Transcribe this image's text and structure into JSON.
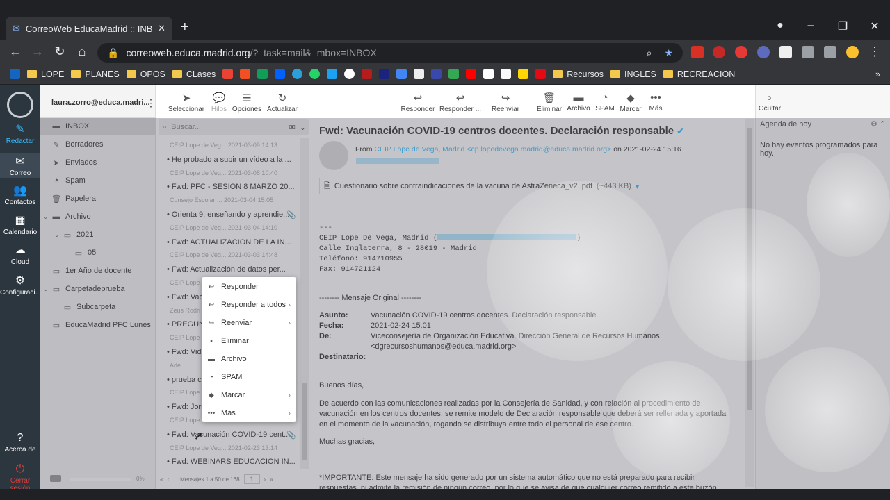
{
  "browser": {
    "tab_title": "CorreoWeb EducaMadrid :: INBOX",
    "url_host": "correoweb.educa.madrid.org",
    "url_path": "/?_task=mail&_mbox=INBOX",
    "bookmarks": [
      "LOPE",
      "PLANES",
      "OPOS",
      "CLases",
      "Recursos",
      "INGLES",
      "RECREACION"
    ]
  },
  "rail": {
    "items": [
      {
        "label": "Redactar",
        "icon": "compose-icon"
      },
      {
        "label": "Correo",
        "icon": "mail-icon"
      },
      {
        "label": "Contactos",
        "icon": "contacts-icon"
      },
      {
        "label": "Calendario",
        "icon": "calendar-icon"
      },
      {
        "label": "Cloud",
        "icon": "cloud-icon"
      },
      {
        "label": "Configuraci...",
        "icon": "gear-icon"
      },
      {
        "label": "Acerca de",
        "icon": "help-icon"
      },
      {
        "label": "Cerrar sesión",
        "icon": "power-icon"
      }
    ]
  },
  "user": {
    "email": "laura.zorro@educa.madri..."
  },
  "folders": [
    {
      "label": "INBOX",
      "icon": "inbox-icon"
    },
    {
      "label": "Borradores",
      "icon": "pencil-icon"
    },
    {
      "label": "Enviados",
      "icon": "send-icon"
    },
    {
      "label": "Spam",
      "icon": "spam-icon"
    },
    {
      "label": "Papelera",
      "icon": "trash-icon"
    },
    {
      "label": "Archivo",
      "icon": "archive-icon"
    },
    {
      "label": "2021",
      "icon": "folder-icon"
    },
    {
      "label": "05",
      "icon": "folder-icon"
    },
    {
      "label": "1er Año de docente",
      "icon": "folder-icon"
    },
    {
      "label": "Carpetadeprueba",
      "icon": "folder-icon"
    },
    {
      "label": "Subcarpeta",
      "icon": "folder-icon"
    },
    {
      "label": "EducaMadrid PFC Lunes",
      "icon": "folder-icon"
    }
  ],
  "list_toolbar": {
    "select": "Seleccionar",
    "threads": "Hilos",
    "options": "Opciones",
    "refresh": "Actualizar"
  },
  "search": {
    "placeholder": "Buscar..."
  },
  "messages": [
    {
      "meta": "CEIP Lope de Veg...  2021-03-09 14:13",
      "subject": ""
    },
    {
      "meta": "",
      "subject": "He probado a subir un vídeo a la ..."
    },
    {
      "meta": "CEIP Lope de Veg...  2021-03-08 10:40",
      "subject": ""
    },
    {
      "meta": "",
      "subject": "Fwd: PFC - SESIÓN 8 MARZO 20..."
    },
    {
      "meta": "Consejo Escolar ...  2021-03-04 15:05",
      "subject": ""
    },
    {
      "meta": "",
      "subject": "Orienta 9: enseñando y aprendie..."
    },
    {
      "meta": "CEIP Lope de Veg...  2021-03-04 14:10",
      "subject": ""
    },
    {
      "meta": "",
      "subject": "Fwd: ACTUALIZACION DE LA IN..."
    },
    {
      "meta": "CEIP Lope de Veg...  2021-03-03 14:48",
      "subject": ""
    },
    {
      "meta": "",
      "subject": "Fwd: Actualización de datos per..."
    },
    {
      "meta": "CEIP Lope",
      "subject": ""
    },
    {
      "meta": "",
      "subject": "Fwd: Vacu"
    },
    {
      "meta": "Zeus Rodri",
      "subject": ""
    },
    {
      "meta": "",
      "subject": "PREGUNT"
    },
    {
      "meta": "CEIP Lope",
      "subject": ""
    },
    {
      "meta": "",
      "subject": "Fwd: Vide"
    },
    {
      "meta": "Ade",
      "subject": ""
    },
    {
      "meta": "",
      "subject": "prueba cu"
    },
    {
      "meta": "CEIP Lope",
      "subject": ""
    },
    {
      "meta": "",
      "subject": "Fwd: Jorn"
    },
    {
      "meta": "CEIP Lope",
      "subject": ""
    },
    {
      "meta": "",
      "subject": "Fwd: Vacunación COVID-19 cent..."
    },
    {
      "meta": "CEIP Lope de Veg...  2021-02-23 13:14",
      "subject": ""
    },
    {
      "meta": "",
      "subject": "Fwd: WEBINARS EDUCACION IN..."
    }
  ],
  "pager": {
    "count": "Mensajes 1 a 50 de 168",
    "page": "1",
    "quota": "0%"
  },
  "msg_toolbar": {
    "reply": "Responder",
    "reply_all": "Responder ...",
    "forward": "Reenviar",
    "delete": "Eliminar",
    "archive": "Archivo",
    "spam": "SPAM",
    "mark": "Marcar",
    "more": "Más"
  },
  "message": {
    "subject": "Fwd: Vacunación COVID-19 centros docentes. Declaración responsable",
    "from_label": "From",
    "from": "CEIP Lope de Vega, Madrid <cp.lopedevega.madrid@educa.madrid.org>",
    "date": "on 2021-02-24 15:16",
    "attachment": "Cuestionario sobre contraindicaciones de la vacuna de AstraZeneca_v2 .pdf",
    "attachment_size": "(~443 KB)",
    "sig_sep": "---",
    "sig_l1": "CEIP Lope De Vega, Madrid (",
    "sig_l2": "Calle Inglaterra, 8 - 28019 - Madrid",
    "sig_l3": "Teléfono: 914710955",
    "sig_l4": "Fax: 914721124",
    "orig": "-------- Mensaje Original --------",
    "k_asunto": "Asunto:",
    "v_asunto": "Vacunación COVID-19 centros docentes. Declaración responsable",
    "k_fecha": "Fecha:",
    "v_fecha": "2021-02-24 15:01",
    "k_de": "De:",
    "v_de": "Viceconsejería de Organización Educativa. Dirección General de Recursos Humanos",
    "v_de2": "<dgrecursoshumanos@educa.madrid.org>",
    "k_dest": "Destinatario:",
    "p1": "Buenos días,",
    "p2": "De acuerdo con las comunicaciones realizadas por la Consejería de Sanidad, y con relación al procedimiento de vacunación en los centros docentes, se remite modelo de Declaración responsable que deberá ser rellenada y aportada en el momento de la vacunación, rogando se distribuya entre todo el personal de ese centro.",
    "p3": "Muchas gracias,",
    "p4": "*IMPORTANTE: Este mensaje ha sido generado por un sistema automático que no está preparado para recibir respuestas, ni admite la remisión de ningún correo, por lo que se avisa de que cualquier correo remitido a este buzón"
  },
  "agenda": {
    "hide": "Ocultar",
    "title": "Agenda de hoy",
    "empty": "No hay eventos programados para hoy."
  },
  "context_menu": [
    {
      "label": "Responder",
      "icon": "reply-icon",
      "sub": false
    },
    {
      "label": "Responder a todos",
      "icon": "reply-all-icon",
      "sub": true
    },
    {
      "label": "Reenviar",
      "icon": "forward-icon",
      "sub": true
    },
    {
      "label": "Eliminar",
      "icon": "trash-icon",
      "sub": false
    },
    {
      "label": "Archivo",
      "icon": "archive-icon",
      "sub": false
    },
    {
      "label": "SPAM",
      "icon": "spam-icon",
      "sub": false
    },
    {
      "label": "Marcar",
      "icon": "tag-icon",
      "sub": true
    },
    {
      "label": "Más",
      "icon": "more-icon",
      "sub": true
    }
  ]
}
